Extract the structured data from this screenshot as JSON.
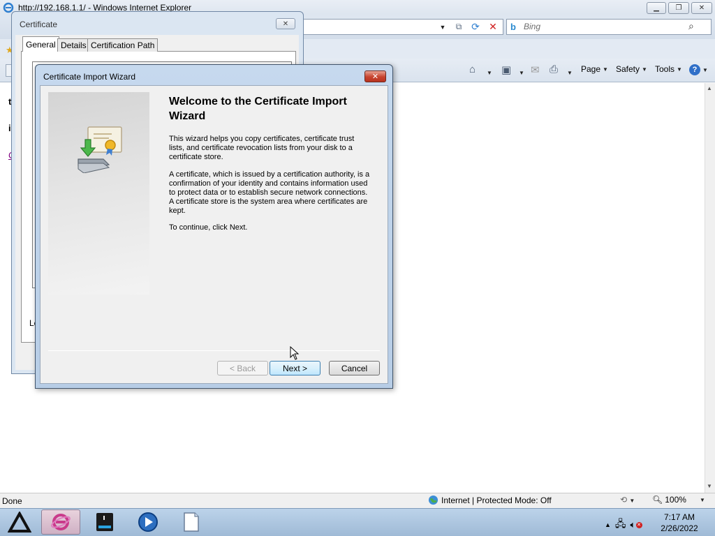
{
  "browser": {
    "title": "http://192.168.1.1/ - Windows Internet Explorer",
    "search_placeholder": "Bing",
    "command_bar": {
      "page": "Page",
      "safety": "Safety",
      "tools": "Tools"
    },
    "page_fragments": [
      "t",
      "i",
      "C"
    ],
    "status": {
      "text": "Done",
      "zone": "Internet | Protected Mode: Off",
      "zoom": "100%"
    }
  },
  "certificate_dialog": {
    "title": "Certificate",
    "tabs": [
      "General",
      "Details",
      "Certification Path"
    ],
    "fragment": "Le"
  },
  "wizard": {
    "title": "Certificate Import Wizard",
    "heading": "Welcome to the Certificate Import Wizard",
    "paragraphs": [
      "This wizard helps you copy certificates, certificate trust lists, and certificate revocation lists from your disk to a certificate store.",
      "A certificate, which is issued by a certification authority, is a confirmation of your identity and contains information used to protect data or to establish secure network connections. A certificate store is the system area where certificates are kept.",
      "To continue, click Next."
    ],
    "buttons": {
      "back": "< Back",
      "next": "Next >",
      "cancel": "Cancel"
    }
  },
  "taskbar": {
    "apps": [
      "app-launcher-icon",
      "internet-explorer-icon",
      "terminal-icon",
      "media-player-icon",
      "notepad-icon"
    ],
    "clock": {
      "time": "7:17 AM",
      "date": "2/26/2022"
    }
  },
  "colors": {
    "titlebar": "#dde5ef",
    "wizard_frame": "#b7cde6",
    "close_red": "#c7432f",
    "taskbar": "#9fbad6"
  }
}
